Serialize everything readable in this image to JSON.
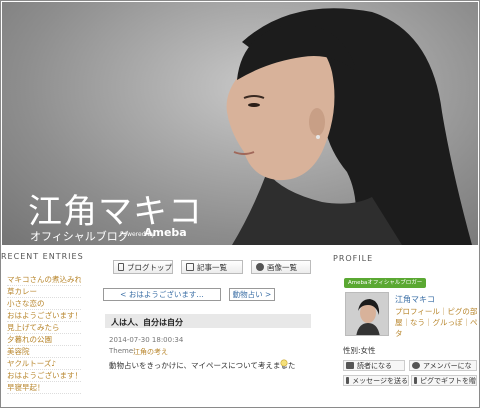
{
  "header": {
    "title": "江角マキコ",
    "subtitle": "オフィシャルブログ",
    "powered": "Powered by",
    "brand": "Ameba"
  },
  "left": {
    "section_title": "RECENT ENTRIES",
    "entries": [
      "マキコさんの煮込みれん",
      "草カレー",
      "小さな恋の",
      "おはようございます！",
      "見上げてみたら",
      "夕暮れの公園",
      "美容院",
      "ヤクルトーズ♪",
      "おはようございます！",
      "早寝早起！"
    ]
  },
  "toolbar": {
    "blog_top": "ブログトップ",
    "entry_list": "記事一覧",
    "image_list": "画像一覧"
  },
  "nav": {
    "prev": "< おはようございます…",
    "next": "動物占い >"
  },
  "entry": {
    "title": "人は人、自分は自分",
    "date": "2014-07-30 18:00:34",
    "theme_label": "Theme:",
    "theme": "江角の考え",
    "body": "動物占いをきっかけに、マイペースについて考えました"
  },
  "profile": {
    "section_title": "PROFILE",
    "badge": "Amebaオフィシャルブロガー",
    "name": "江角マキコ",
    "links": "プロフィール｜ピグの部屋｜なう｜グルっぽ｜ペタ",
    "gender": "性別:女性",
    "btn_reader": "読者になる",
    "btn_amember": "アメンバーにな",
    "btn_message": "メッセージを送る",
    "btn_gift": "ピグでギフトを贈"
  },
  "colors": {
    "link_gold": "#b8862c",
    "link_blue": "#3a6ea5",
    "badge_green": "#5aa832"
  }
}
